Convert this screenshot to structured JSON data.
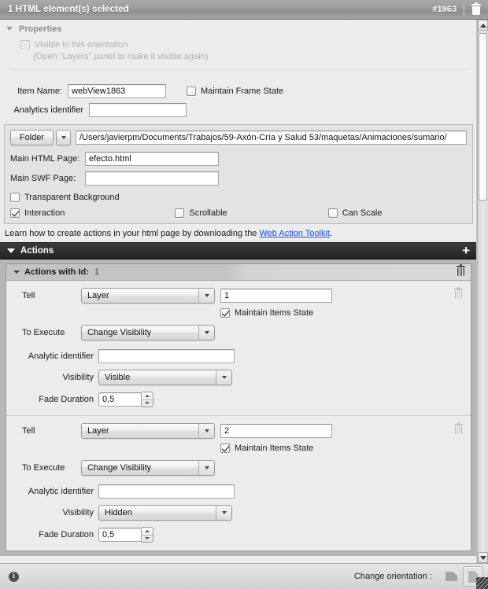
{
  "titlebar": {
    "selection_text": "1 HTML element(s) selected",
    "element_id": "#1863",
    "delete_icon": "trash-icon"
  },
  "properties": {
    "section_label": "Properties",
    "visible_checkbox_label": "Visible in this orientation",
    "visible_checkbox_checked": false,
    "visible_note": "(Open \"Layers\" panel to make it visible again)",
    "item_name_label": "Item Name:",
    "item_name_value": "webView1863",
    "maintain_frame_state_label": "Maintain Frame State",
    "maintain_frame_state_checked": false,
    "analytics_identifier_label": "Analytics identifier",
    "analytics_identifier_value": ""
  },
  "source": {
    "folder_button_label": "Folder",
    "folder_path": "/Users/javierpm/Documents/Trabajos/59-Axón-Cría y Salud 53/maquetas/Animaciones/sumario/",
    "main_html_label": "Main HTML Page:",
    "main_html_value": "efecto.html",
    "main_swf_label": "Main SWF Page:",
    "main_swf_value": "",
    "transparent_background_label": "Transparent Background",
    "transparent_background_checked": false,
    "interaction_label": "Interaction",
    "interaction_checked": true,
    "scrollable_label": "Scrollable",
    "scrollable_checked": false,
    "can_scale_label": "Can Scale",
    "can_scale_checked": false
  },
  "learn": {
    "text_before": "Learn how to create actions in your html page by downloading the ",
    "link_text": "Web Action Toolkit",
    "text_after": "."
  },
  "actions": {
    "header_label": "Actions",
    "add_label": "+",
    "group": {
      "title": "Actions with Id:",
      "id": "1",
      "delete_icon": "trash-icon"
    },
    "items": [
      {
        "tell_label": "Tell",
        "tell_type": "Layer",
        "tell_value": "1",
        "maintain_items_state_label": "Maintain Items State",
        "maintain_items_state_checked": true,
        "to_execute_label": "To Execute",
        "to_execute_value": "Change Visibility",
        "analytic_identifier_label": "Analytic identifier",
        "analytic_identifier_value": "",
        "visibility_label": "Visibility",
        "visibility_value": "Visible",
        "fade_duration_label": "Fade Duration",
        "fade_duration_value": "0,5"
      },
      {
        "tell_label": "Tell",
        "tell_type": "Layer",
        "tell_value": "2",
        "maintain_items_state_label": "Maintain Items State",
        "maintain_items_state_checked": true,
        "to_execute_label": "To Execute",
        "to_execute_value": "Change Visibility",
        "analytic_identifier_label": "Analytic identifier",
        "analytic_identifier_value": "",
        "visibility_label": "Visibility",
        "visibility_value": "Hidden",
        "fade_duration_label": "Fade Duration",
        "fade_duration_value": "0,5"
      }
    ]
  },
  "statusbar": {
    "info_icon": "info-icon",
    "info_glyph": "i",
    "change_orientation_label": "Change orientation :",
    "landscape_icon": "landscape-page-icon",
    "portrait_icon": "portrait-page-icon",
    "selected_orientation": "portrait"
  }
}
